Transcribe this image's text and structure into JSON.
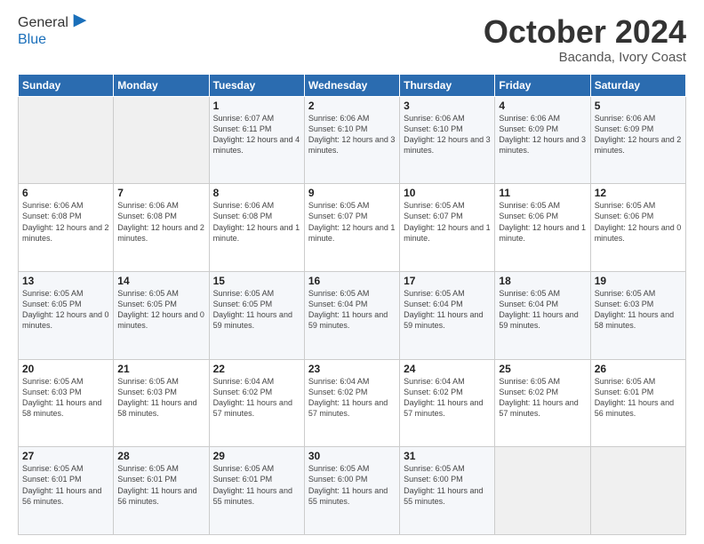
{
  "header": {
    "logo_line1": "General",
    "logo_line2": "Blue",
    "month": "October 2024",
    "location": "Bacanda, Ivory Coast"
  },
  "weekdays": [
    "Sunday",
    "Monday",
    "Tuesday",
    "Wednesday",
    "Thursday",
    "Friday",
    "Saturday"
  ],
  "weeks": [
    [
      {
        "day": "",
        "info": ""
      },
      {
        "day": "",
        "info": ""
      },
      {
        "day": "1",
        "info": "Sunrise: 6:07 AM\nSunset: 6:11 PM\nDaylight: 12 hours and 4 minutes."
      },
      {
        "day": "2",
        "info": "Sunrise: 6:06 AM\nSunset: 6:10 PM\nDaylight: 12 hours and 3 minutes."
      },
      {
        "day": "3",
        "info": "Sunrise: 6:06 AM\nSunset: 6:10 PM\nDaylight: 12 hours and 3 minutes."
      },
      {
        "day": "4",
        "info": "Sunrise: 6:06 AM\nSunset: 6:09 PM\nDaylight: 12 hours and 3 minutes."
      },
      {
        "day": "5",
        "info": "Sunrise: 6:06 AM\nSunset: 6:09 PM\nDaylight: 12 hours and 2 minutes."
      }
    ],
    [
      {
        "day": "6",
        "info": "Sunrise: 6:06 AM\nSunset: 6:08 PM\nDaylight: 12 hours and 2 minutes."
      },
      {
        "day": "7",
        "info": "Sunrise: 6:06 AM\nSunset: 6:08 PM\nDaylight: 12 hours and 2 minutes."
      },
      {
        "day": "8",
        "info": "Sunrise: 6:06 AM\nSunset: 6:08 PM\nDaylight: 12 hours and 1 minute."
      },
      {
        "day": "9",
        "info": "Sunrise: 6:05 AM\nSunset: 6:07 PM\nDaylight: 12 hours and 1 minute."
      },
      {
        "day": "10",
        "info": "Sunrise: 6:05 AM\nSunset: 6:07 PM\nDaylight: 12 hours and 1 minute."
      },
      {
        "day": "11",
        "info": "Sunrise: 6:05 AM\nSunset: 6:06 PM\nDaylight: 12 hours and 1 minute."
      },
      {
        "day": "12",
        "info": "Sunrise: 6:05 AM\nSunset: 6:06 PM\nDaylight: 12 hours and 0 minutes."
      }
    ],
    [
      {
        "day": "13",
        "info": "Sunrise: 6:05 AM\nSunset: 6:05 PM\nDaylight: 12 hours and 0 minutes."
      },
      {
        "day": "14",
        "info": "Sunrise: 6:05 AM\nSunset: 6:05 PM\nDaylight: 12 hours and 0 minutes."
      },
      {
        "day": "15",
        "info": "Sunrise: 6:05 AM\nSunset: 6:05 PM\nDaylight: 11 hours and 59 minutes."
      },
      {
        "day": "16",
        "info": "Sunrise: 6:05 AM\nSunset: 6:04 PM\nDaylight: 11 hours and 59 minutes."
      },
      {
        "day": "17",
        "info": "Sunrise: 6:05 AM\nSunset: 6:04 PM\nDaylight: 11 hours and 59 minutes."
      },
      {
        "day": "18",
        "info": "Sunrise: 6:05 AM\nSunset: 6:04 PM\nDaylight: 11 hours and 59 minutes."
      },
      {
        "day": "19",
        "info": "Sunrise: 6:05 AM\nSunset: 6:03 PM\nDaylight: 11 hours and 58 minutes."
      }
    ],
    [
      {
        "day": "20",
        "info": "Sunrise: 6:05 AM\nSunset: 6:03 PM\nDaylight: 11 hours and 58 minutes."
      },
      {
        "day": "21",
        "info": "Sunrise: 6:05 AM\nSunset: 6:03 PM\nDaylight: 11 hours and 58 minutes."
      },
      {
        "day": "22",
        "info": "Sunrise: 6:04 AM\nSunset: 6:02 PM\nDaylight: 11 hours and 57 minutes."
      },
      {
        "day": "23",
        "info": "Sunrise: 6:04 AM\nSunset: 6:02 PM\nDaylight: 11 hours and 57 minutes."
      },
      {
        "day": "24",
        "info": "Sunrise: 6:04 AM\nSunset: 6:02 PM\nDaylight: 11 hours and 57 minutes."
      },
      {
        "day": "25",
        "info": "Sunrise: 6:05 AM\nSunset: 6:02 PM\nDaylight: 11 hours and 57 minutes."
      },
      {
        "day": "26",
        "info": "Sunrise: 6:05 AM\nSunset: 6:01 PM\nDaylight: 11 hours and 56 minutes."
      }
    ],
    [
      {
        "day": "27",
        "info": "Sunrise: 6:05 AM\nSunset: 6:01 PM\nDaylight: 11 hours and 56 minutes."
      },
      {
        "day": "28",
        "info": "Sunrise: 6:05 AM\nSunset: 6:01 PM\nDaylight: 11 hours and 56 minutes."
      },
      {
        "day": "29",
        "info": "Sunrise: 6:05 AM\nSunset: 6:01 PM\nDaylight: 11 hours and 55 minutes."
      },
      {
        "day": "30",
        "info": "Sunrise: 6:05 AM\nSunset: 6:00 PM\nDaylight: 11 hours and 55 minutes."
      },
      {
        "day": "31",
        "info": "Sunrise: 6:05 AM\nSunset: 6:00 PM\nDaylight: 11 hours and 55 minutes."
      },
      {
        "day": "",
        "info": ""
      },
      {
        "day": "",
        "info": ""
      }
    ]
  ]
}
